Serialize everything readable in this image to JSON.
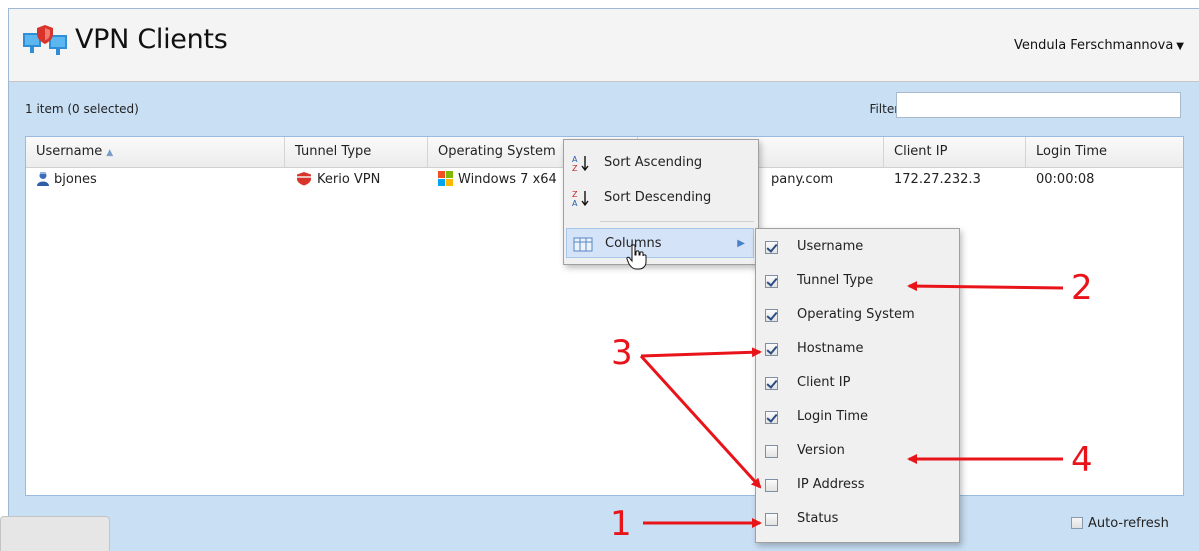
{
  "header": {
    "title": "VPN Clients",
    "user": "Vendula Ferschmannova"
  },
  "toolbar": {
    "item_count": "1 item (0 selected)",
    "filter_label": "Filter:",
    "filter_value": ""
  },
  "grid": {
    "columns": [
      "Username",
      "Tunnel Type",
      "Operating System",
      "",
      "Client IP",
      "Login Time"
    ],
    "rows": [
      {
        "username": "bjones",
        "tunnel_type": "Kerio VPN",
        "os": "Windows 7 x64",
        "hostname": "pany.com",
        "client_ip": "172.27.232.3",
        "login_time": "00:00:08"
      }
    ]
  },
  "context_menu": {
    "sort_asc": "Sort Ascending",
    "sort_desc": "Sort Descending",
    "columns": "Columns"
  },
  "columns_menu": [
    {
      "label": "Username",
      "checked": true
    },
    {
      "label": "Tunnel Type",
      "checked": true
    },
    {
      "label": "Operating System",
      "checked": true
    },
    {
      "label": "Hostname",
      "checked": true
    },
    {
      "label": "Client IP",
      "checked": true
    },
    {
      "label": "Login Time",
      "checked": true
    },
    {
      "label": "Version",
      "checked": false
    },
    {
      "label": "IP Address",
      "checked": false
    },
    {
      "label": "Status",
      "checked": false
    }
  ],
  "footer": {
    "auto_refresh": "Auto-refresh"
  },
  "annotations": [
    "1",
    "2",
    "3",
    "4"
  ],
  "colors": {
    "annotation": "#e8141a",
    "accent": "#4a80c8"
  }
}
